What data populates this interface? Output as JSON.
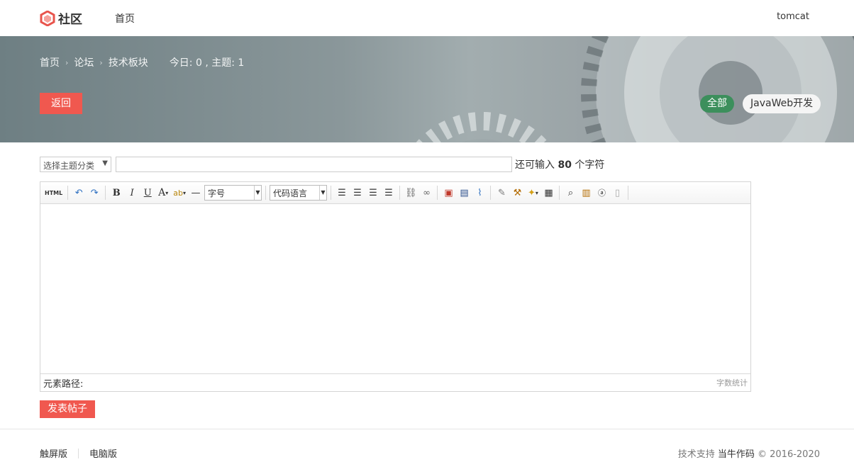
{
  "header": {
    "brand": "社区",
    "nav_home": "首页",
    "user": "tomcat"
  },
  "banner": {
    "breadcrumb": [
      "首页",
      "论坛",
      "技术板块"
    ],
    "stats": "今日: 0 , 主题: 1",
    "back_label": "返回",
    "filter_all": "全部",
    "filter_category": "JavaWeb开发"
  },
  "form": {
    "category_select": "选择主题分类",
    "title_value": "",
    "remaining_prefix": "还可输入",
    "remaining_count": "80",
    "remaining_suffix": "个字符"
  },
  "editor": {
    "html_label": "HTML",
    "font_size_combo": "字号",
    "code_lang_combo": "代码语言",
    "element_path": "元素路径:",
    "word_count": "字数统计"
  },
  "submit_label": "发表帖子",
  "footer": {
    "touch": "触屏版",
    "desktop": "电脑版",
    "support_prefix": "技术支持",
    "support_name": "当牛作码",
    "copyright": "© 2016-2020"
  },
  "colors": {
    "accent_red": "#f0584f",
    "accent_green": "#3c8f5c"
  }
}
